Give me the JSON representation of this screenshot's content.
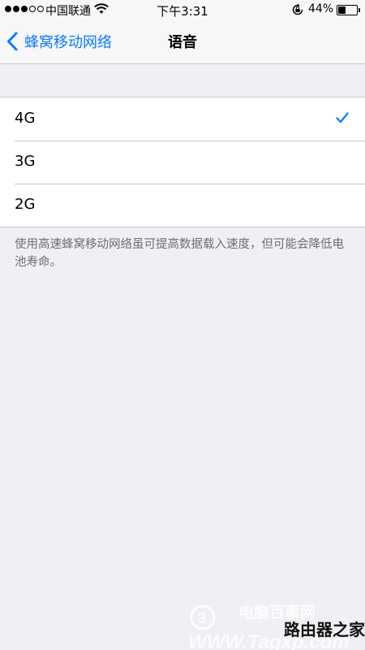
{
  "status_bar": {
    "carrier": "中国联通",
    "time": "下午3:31",
    "battery_percent": "44%",
    "battery_level": 0.44,
    "signal_bars_filled": 3,
    "signal_bars_total": 5
  },
  "nav": {
    "back_label": "蜂窝移动网络",
    "title": "语音"
  },
  "options": [
    {
      "label": "4G",
      "selected": true
    },
    {
      "label": "3G",
      "selected": false
    },
    {
      "label": "2G",
      "selected": false
    }
  ],
  "footer_note": "使用高速蜂窝移动网络虽可提高数据载入速度，但可能会降低电池寿命。",
  "watermark": {
    "line1": "电脑百事网",
    "line2": "路由器之家",
    "line3": "WWW.Tagxp.com"
  },
  "colors": {
    "accent": "#0a7aff",
    "background": "#efeff4",
    "separator": "#c8c7cc",
    "footer_text": "#6d6d72"
  }
}
